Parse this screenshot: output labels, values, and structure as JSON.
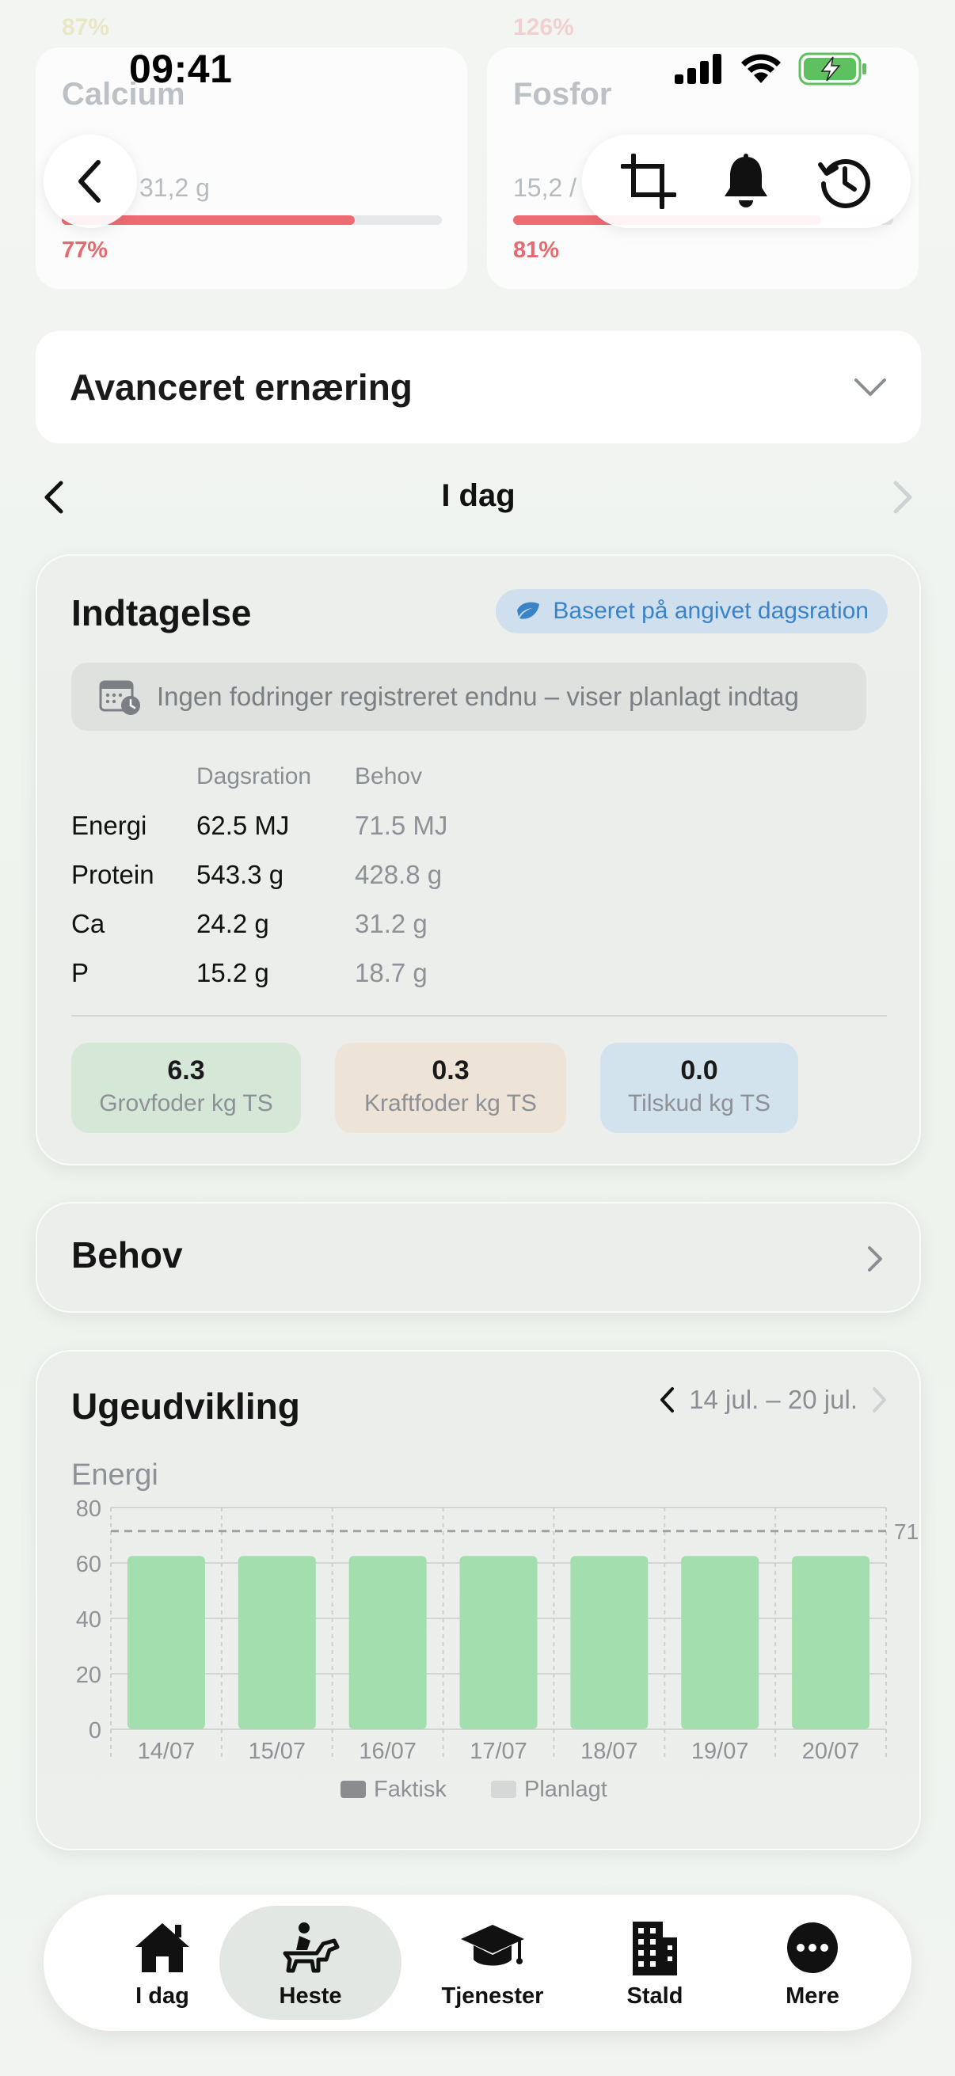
{
  "top_cards": {
    "ghost_left_pct": "87%",
    "ghost_right_pct": "126%",
    "left": {
      "title": "Calcium",
      "value": "31,2 g",
      "progress": 0.77,
      "pct": "77%"
    },
    "right": {
      "title": "Fosfor",
      "value": "15,2 /",
      "progress": 0.81,
      "pct": "81%"
    }
  },
  "status": {
    "time": "09:41"
  },
  "advanced": {
    "title": "Avanceret ernæring"
  },
  "daynav": {
    "label": "I dag"
  },
  "intake": {
    "title": "Indtagelse",
    "badge": "Baseret på angivet dagsration",
    "notice": "Ingen fodringer registreret endnu – viser planlagt indtag",
    "col_ration": "Dagsration",
    "col_need": "Behov",
    "rows": [
      {
        "label": "Energi",
        "ration": "62.5 MJ",
        "need": "71.5 MJ"
      },
      {
        "label": "Protein",
        "ration": "543.3 g",
        "need": "428.8 g"
      },
      {
        "label": "Ca",
        "ration": "24.2 g",
        "need": "31.2 g"
      },
      {
        "label": "P",
        "ration": "15.2 g",
        "need": "18.7 g"
      }
    ],
    "chips": [
      {
        "value": "6.3",
        "label": "Grovfoder kg TS",
        "color": "#d5e8d7"
      },
      {
        "value": "0.3",
        "label": "Kraftfoder kg TS",
        "color": "#ede3d7"
      },
      {
        "value": "0.0",
        "label": "Tilskud kg TS",
        "color": "#d3e3ee"
      }
    ]
  },
  "behov": {
    "title": "Behov"
  },
  "weekly": {
    "title": "Ugeudvikling",
    "range": "14 jul. – 20 jul."
  },
  "chart_data": {
    "type": "bar",
    "title": "Energi",
    "categories": [
      "14/07",
      "15/07",
      "16/07",
      "17/07",
      "18/07",
      "19/07",
      "20/07"
    ],
    "series": [
      {
        "name": "Faktisk",
        "values": [
          0,
          0,
          0,
          0,
          0,
          0,
          0
        ],
        "color": "#8a8c8e"
      },
      {
        "name": "Planlagt",
        "values": [
          62.5,
          62.5,
          62.5,
          62.5,
          62.5,
          62.5,
          62.5
        ],
        "color": "#a3dfae"
      }
    ],
    "yticks": [
      0,
      20,
      40,
      60,
      80
    ],
    "ylim": [
      0,
      80
    ],
    "reference_line": {
      "value": 71.5,
      "label": "71"
    },
    "grid": true,
    "legend_position": "bottom"
  },
  "tabs": [
    {
      "label": "I dag",
      "icon": "house-icon"
    },
    {
      "label": "Heste",
      "icon": "horse-rider-icon",
      "active": true
    },
    {
      "label": "Tjenester",
      "icon": "graduation-cap-icon"
    },
    {
      "label": "Stald",
      "icon": "building-icon"
    },
    {
      "label": "Mere",
      "icon": "more-icon"
    }
  ]
}
